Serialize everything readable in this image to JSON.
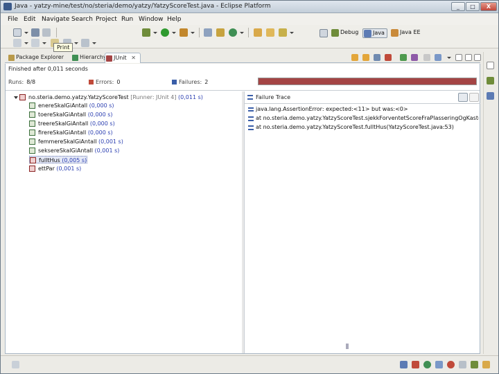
{
  "window": {
    "title": "Java - yatzy-mine/test/no/steria/demo/yatzy/YatzyScoreTest.java - Eclipse Platform",
    "minimize_label": "_",
    "maximize_label": "□",
    "close_label": "X"
  },
  "menu": [
    "File",
    "Edit",
    "Navigate",
    "Search",
    "Project",
    "Run",
    "Window",
    "Help"
  ],
  "toolbar": {
    "tooltip": "Print"
  },
  "perspectives": [
    {
      "label": "Debug",
      "active": false
    },
    {
      "label": "Java",
      "active": true
    },
    {
      "label": "Java EE",
      "active": false
    }
  ],
  "view_tabs": [
    {
      "label": "Package Explorer",
      "active": false
    },
    {
      "label": "Hierarchy",
      "active": false
    },
    {
      "label": "JUnit",
      "active": true
    }
  ],
  "junit": {
    "status": "Finished after 0,011 seconds",
    "runs_label": "Runs:",
    "runs_value": "8/8",
    "errors_label": "Errors:",
    "errors_value": "0",
    "failures_label": "Failures:",
    "failures_value": "2",
    "progress_fraction": 1.0,
    "progress_color": "#a44444",
    "root": {
      "name": "no.steria.demo.yatzy.YatzyScoreTest",
      "runner": "[Runner: JUnit 4]",
      "time": "(0,011 s)"
    },
    "tests": [
      {
        "name": "enereSkalGiAntall",
        "time": "(0,000 s)",
        "status": "pass"
      },
      {
        "name": "toereSkalGiAntall",
        "time": "(0,000 s)",
        "status": "pass"
      },
      {
        "name": "treereSkalGiAntall",
        "time": "(0,000 s)",
        "status": "pass"
      },
      {
        "name": "firereSkalGiAntall",
        "time": "(0,000 s)",
        "status": "pass"
      },
      {
        "name": "femmereSkalGiAntall",
        "time": "(0,001 s)",
        "status": "pass"
      },
      {
        "name": "seksereSkalGiAntall",
        "time": "(0,001 s)",
        "status": "pass"
      },
      {
        "name": "fulltHus",
        "time": "(0,005 s)",
        "status": "fail",
        "selected": true
      },
      {
        "name": "ettPar",
        "time": "(0,001 s)",
        "status": "fail"
      }
    ],
    "trace_title": "Failure Trace",
    "trace_lines": [
      "java.lang.AssertionError: expected:<11> but was:<0>",
      "at no.steria.demo.yatzy.YatzyScoreTest.sjekkForventetScoreFraPlasseringOgKast(YatzyScoreTest.java:73)",
      "at no.steria.demo.yatzy.YatzyScoreTest.fulltHus(YatzyScoreTest.java:53)"
    ]
  }
}
